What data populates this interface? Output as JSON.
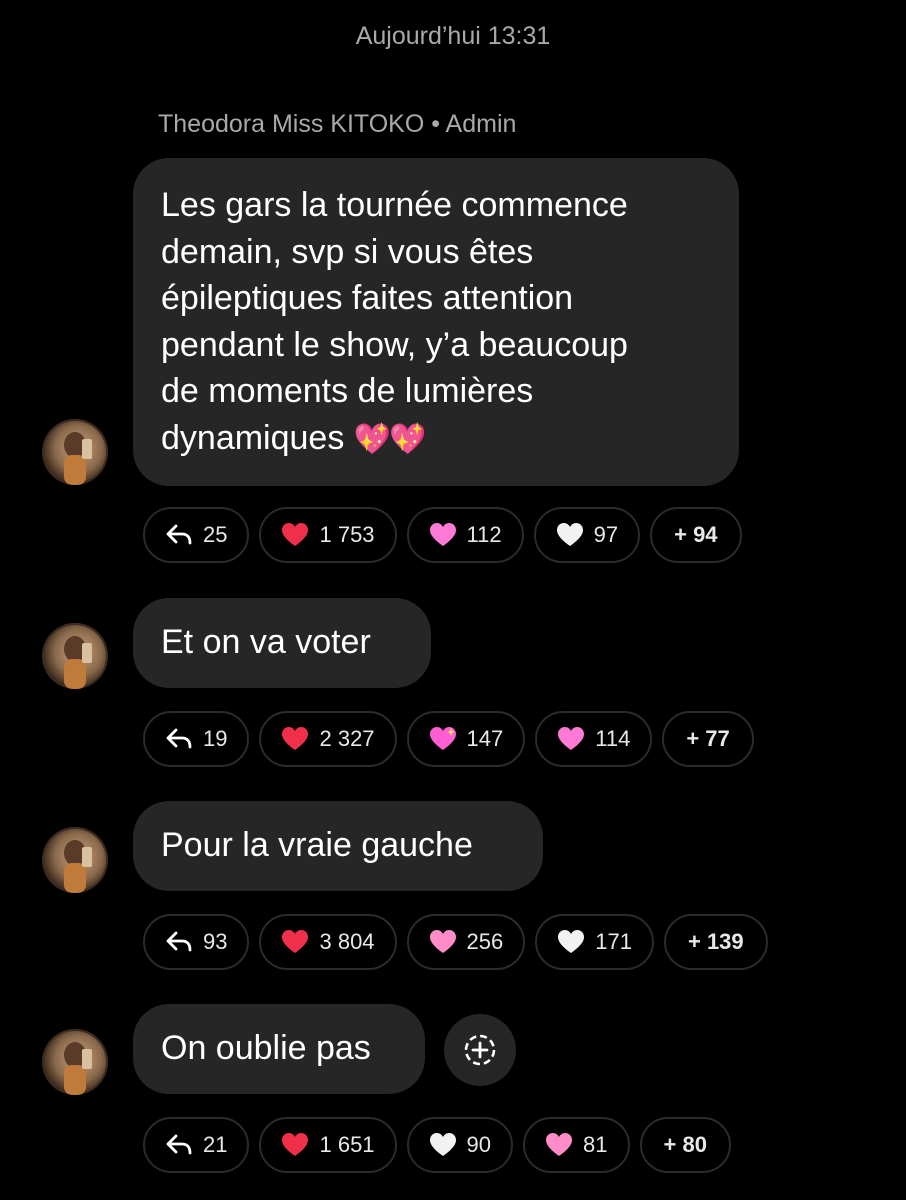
{
  "header": {
    "timestamp": "Aujourd’hui 13:31"
  },
  "sender": {
    "label": "Theodora Miss KITOKO • Admin"
  },
  "messages": [
    {
      "lines": [
        "Les gars la tournée commence",
        "demain, svp si vous êtes",
        "épileptiques faites attention",
        "pendant le show, y’a beaucoup",
        "de moments de lumières",
        "dynamiques"
      ],
      "emoji": "💖💖",
      "reactions": {
        "replies": "25",
        "items": [
          {
            "icon": "red-heart",
            "count": "1 753"
          },
          {
            "icon": "pink-heart",
            "count": "112"
          },
          {
            "icon": "white-heart",
            "count": "97"
          }
        ],
        "more": "+ 94"
      }
    },
    {
      "lines": [
        "Et on va voter"
      ],
      "reactions": {
        "replies": "19",
        "items": [
          {
            "icon": "red-heart",
            "count": "2 327"
          },
          {
            "icon": "sparkling-heart",
            "count": "147"
          },
          {
            "icon": "pink-heart",
            "count": "114"
          }
        ],
        "more": "+ 77"
      }
    },
    {
      "lines": [
        "Pour la vraie gauche"
      ],
      "reactions": {
        "replies": "93",
        "items": [
          {
            "icon": "red-heart",
            "count": "3 804"
          },
          {
            "icon": "pink-heart",
            "count": "256"
          },
          {
            "icon": "white-heart",
            "count": "171"
          }
        ],
        "more": "+ 139"
      }
    },
    {
      "lines": [
        "On oublie pas"
      ],
      "reactions": {
        "replies": "21",
        "items": [
          {
            "icon": "red-heart",
            "count": "1 651"
          },
          {
            "icon": "white-heart",
            "count": "90"
          },
          {
            "icon": "pink-heart",
            "count": "81"
          }
        ],
        "more": "+ 80"
      }
    }
  ],
  "colors": {
    "background": "#000000",
    "bubble": "#262626",
    "meta_text": "#a9a9a9",
    "red_heart": "#f0304a",
    "pink_heart": "#ff7ad6",
    "white_heart": "#f2f2f2"
  }
}
